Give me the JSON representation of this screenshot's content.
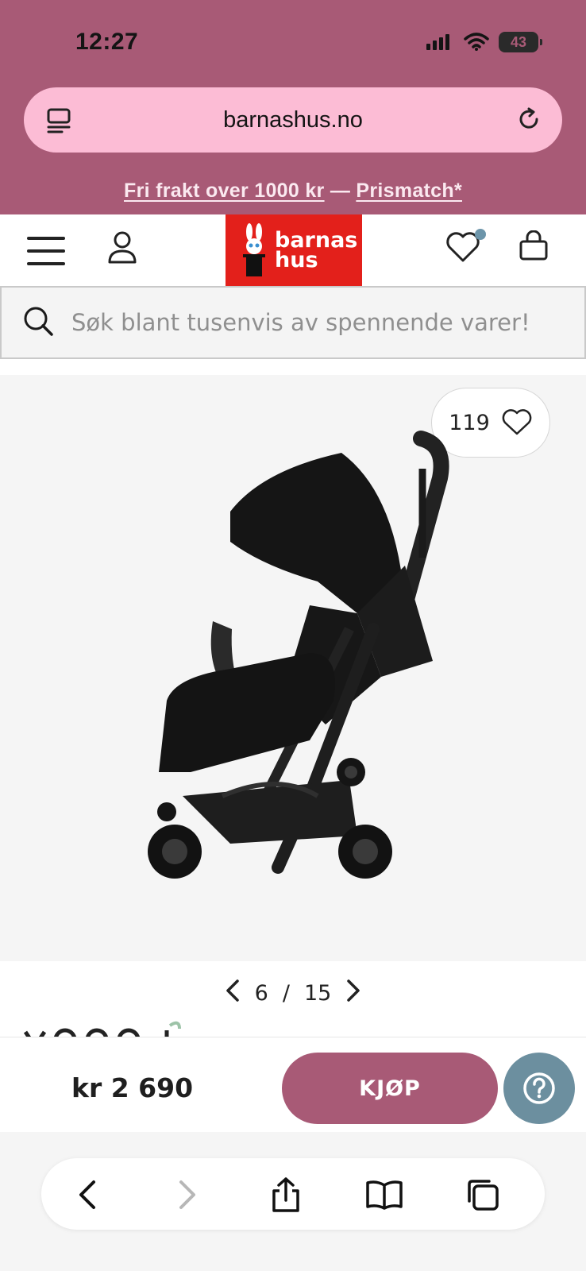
{
  "status_bar": {
    "time": "12:27",
    "battery": "43"
  },
  "browser": {
    "url": "barnashus.no"
  },
  "promo": {
    "free_shipping": "Fri frakt over 1000 kr",
    "separator": " — ",
    "price_match": "Prismatch*"
  },
  "header": {
    "logo_line1": "barnas",
    "logo_line2": "hus"
  },
  "search": {
    "placeholder": "Søk blant tusenvis av spennende varer!"
  },
  "product": {
    "like_count": "119",
    "current_image": "6",
    "separator": "/",
    "total_images": "15"
  },
  "buy_bar": {
    "price": "kr 2 690",
    "buy_label": "KJØP"
  },
  "colors": {
    "brand_pink": "#a85a76",
    "url_bar_pink": "#fcbcd5",
    "logo_red": "#e3201b",
    "help_blue": "#6c8f9f"
  }
}
